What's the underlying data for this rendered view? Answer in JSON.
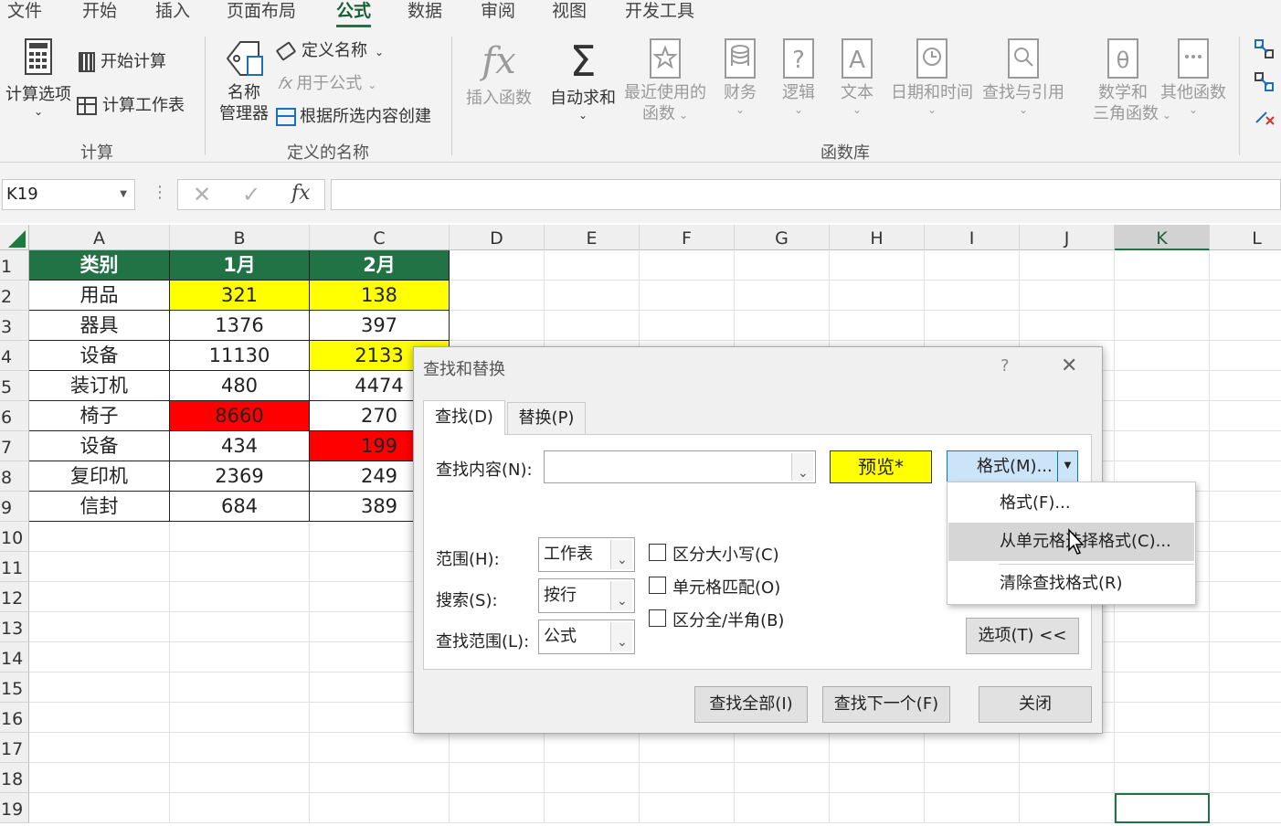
{
  "ribbon_tabs": [
    "文件",
    "开始",
    "插入",
    "页面布局",
    "公式",
    "数据",
    "审阅",
    "视图",
    "开发工具"
  ],
  "ribbon": {
    "calc_options": "计算选项",
    "calc_now": "开始计算",
    "calc_sheet": "计算工作表",
    "group_calc": "计算",
    "name_mgr_1": "名称",
    "name_mgr_2": "管理器",
    "define_name": "定义名称",
    "use_in_formula": "用于公式",
    "create_from_sel": "根据所选内容创建",
    "group_names": "定义的名称",
    "insert_function": "插入函数",
    "autosum": "自动求和",
    "recent_1": "最近使用的",
    "recent_2": "函数",
    "financial": "财务",
    "logical": "逻辑",
    "text": "文本",
    "datetime": "日期和时间",
    "lookup": "查找与引用",
    "math_1": "数学和",
    "math_2": "三角函数",
    "more": "其他函数",
    "group_library": "函数库"
  },
  "formula_bar": {
    "name_box": "K19",
    "formula": ""
  },
  "columns": [
    "A",
    "B",
    "C",
    "D",
    "E",
    "F",
    "G",
    "H",
    "I",
    "J",
    "K",
    "L"
  ],
  "selected_column": "K",
  "rows": [
    "1",
    "2",
    "3",
    "4",
    "5",
    "6",
    "7",
    "8",
    "9",
    "10",
    "11",
    "12",
    "13",
    "14",
    "15",
    "16",
    "17",
    "18",
    "19"
  ],
  "table": {
    "headers": [
      "类别",
      "1月",
      "2月"
    ],
    "header_bg": "#217346",
    "highlight_yellow": "#ffff00",
    "highlight_red": "#ff0000",
    "rows": [
      {
        "cat": "用品",
        "jan": "321",
        "feb": "138"
      },
      {
        "cat": "器具",
        "jan": "1376",
        "feb": "397"
      },
      {
        "cat": "设备",
        "jan": "11130",
        "feb": "2133"
      },
      {
        "cat": "装订机",
        "jan": "480",
        "feb": "4474"
      },
      {
        "cat": "椅子",
        "jan": "8660",
        "feb": "270"
      },
      {
        "cat": "设备",
        "jan": "434",
        "feb": "199"
      },
      {
        "cat": "复印机",
        "jan": "2369",
        "feb": "249"
      },
      {
        "cat": "信封",
        "jan": "684",
        "feb": "389"
      }
    ]
  },
  "dialog": {
    "title": "查找和替换",
    "help": "?",
    "tab_find": "查找(D)",
    "tab_replace": "替换(P)",
    "find_label": "查找内容(N):",
    "find_value": "",
    "preview": "预览*",
    "format_btn": "格式(M)...",
    "scope_label": "范围(H):",
    "scope_value": "工作表",
    "search_label": "搜索(S):",
    "search_value": "按行",
    "lookin_label": "查找范围(L):",
    "lookin_value": "公式",
    "match_case": "区分大小写(C)",
    "match_cell": "单元格匹配(O)",
    "match_width": "区分全/半角(B)",
    "options_btn": "选项(T) <<",
    "find_all": "查找全部(I)",
    "find_next": "查找下一个(F)",
    "close": "关闭"
  },
  "format_menu": {
    "item1": "格式(F)...",
    "item2": "从单元格选择格式(C)...",
    "item3": "清除查找格式(R)"
  }
}
